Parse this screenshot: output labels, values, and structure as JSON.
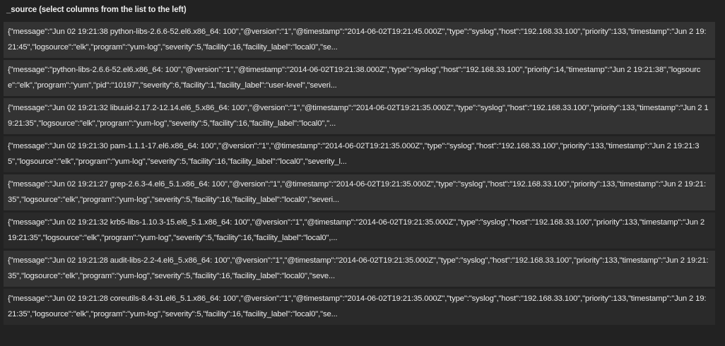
{
  "header": {
    "title": "_source (select columns from the list to the left)"
  },
  "rows": [
    "{\"message\":\"Jun 02 19:21:38 python-libs-2.6.6-52.el6.x86_64: 100\",\"@version\":\"1\",\"@timestamp\":\"2014-06-02T19:21:45.000Z\",\"type\":\"syslog\",\"host\":\"192.168.33.100\",\"priority\":133,\"timestamp\":\"Jun 2 19:21:45\",\"logsource\":\"elk\",\"program\":\"yum-log\",\"severity\":5,\"facility\":16,\"facility_label\":\"local0\",\"se...",
    "{\"message\":\"python-libs-2.6.6-52.el6.x86_64: 100\",\"@version\":\"1\",\"@timestamp\":\"2014-06-02T19:21:38.000Z\",\"type\":\"syslog\",\"host\":\"192.168.33.100\",\"priority\":14,\"timestamp\":\"Jun 2 19:21:38\",\"logsource\":\"elk\",\"program\":\"yum\",\"pid\":\"10197\",\"severity\":6,\"facility\":1,\"facility_label\":\"user-level\",\"severi...",
    "{\"message\":\"Jun 02 19:21:32 libuuid-2.17.2-12.14.el6_5.x86_64: 100\",\"@version\":\"1\",\"@timestamp\":\"2014-06-02T19:21:35.000Z\",\"type\":\"syslog\",\"host\":\"192.168.33.100\",\"priority\":133,\"timestamp\":\"Jun 2 19:21:35\",\"logsource\":\"elk\",\"program\":\"yum-log\",\"severity\":5,\"facility\":16,\"facility_label\":\"local0\",\"...",
    "{\"message\":\"Jun 02 19:21:30 pam-1.1.1-17.el6.x86_64: 100\",\"@version\":\"1\",\"@timestamp\":\"2014-06-02T19:21:35.000Z\",\"type\":\"syslog\",\"host\":\"192.168.33.100\",\"priority\":133,\"timestamp\":\"Jun 2 19:21:35\",\"logsource\":\"elk\",\"program\":\"yum-log\",\"severity\":5,\"facility\":16,\"facility_label\":\"local0\",\"severity_l...",
    "{\"message\":\"Jun 02 19:21:27 grep-2.6.3-4.el6_5.1.x86_64: 100\",\"@version\":\"1\",\"@timestamp\":\"2014-06-02T19:21:35.000Z\",\"type\":\"syslog\",\"host\":\"192.168.33.100\",\"priority\":133,\"timestamp\":\"Jun 2 19:21:35\",\"logsource\":\"elk\",\"program\":\"yum-log\",\"severity\":5,\"facility\":16,\"facility_label\":\"local0\",\"severi...",
    "{\"message\":\"Jun 02 19:21:32 krb5-libs-1.10.3-15.el6_5.1.x86_64: 100\",\"@version\":\"1\",\"@timestamp\":\"2014-06-02T19:21:35.000Z\",\"type\":\"syslog\",\"host\":\"192.168.33.100\",\"priority\":133,\"timestamp\":\"Jun 2 19:21:35\",\"logsource\":\"elk\",\"program\":\"yum-log\",\"severity\":5,\"facility\":16,\"facility_label\":\"local0\",...",
    "{\"message\":\"Jun 02 19:21:28 audit-libs-2.2-4.el6_5.x86_64: 100\",\"@version\":\"1\",\"@timestamp\":\"2014-06-02T19:21:35.000Z\",\"type\":\"syslog\",\"host\":\"192.168.33.100\",\"priority\":133,\"timestamp\":\"Jun 2 19:21:35\",\"logsource\":\"elk\",\"program\":\"yum-log\",\"severity\":5,\"facility\":16,\"facility_label\":\"local0\",\"seve...",
    "{\"message\":\"Jun 02 19:21:28 coreutils-8.4-31.el6_5.1.x86_64: 100\",\"@version\":\"1\",\"@timestamp\":\"2014-06-02T19:21:35.000Z\",\"type\":\"syslog\",\"host\":\"192.168.33.100\",\"priority\":133,\"timestamp\":\"Jun 2 19:21:35\",\"logsource\":\"elk\",\"program\":\"yum-log\",\"severity\":5,\"facility\":16,\"facility_label\":\"local0\",\"se..."
  ],
  "colors": {
    "background": "#222222",
    "row_dark": "#333333",
    "row_light": "#2a2a2a",
    "text": "#ececec"
  }
}
